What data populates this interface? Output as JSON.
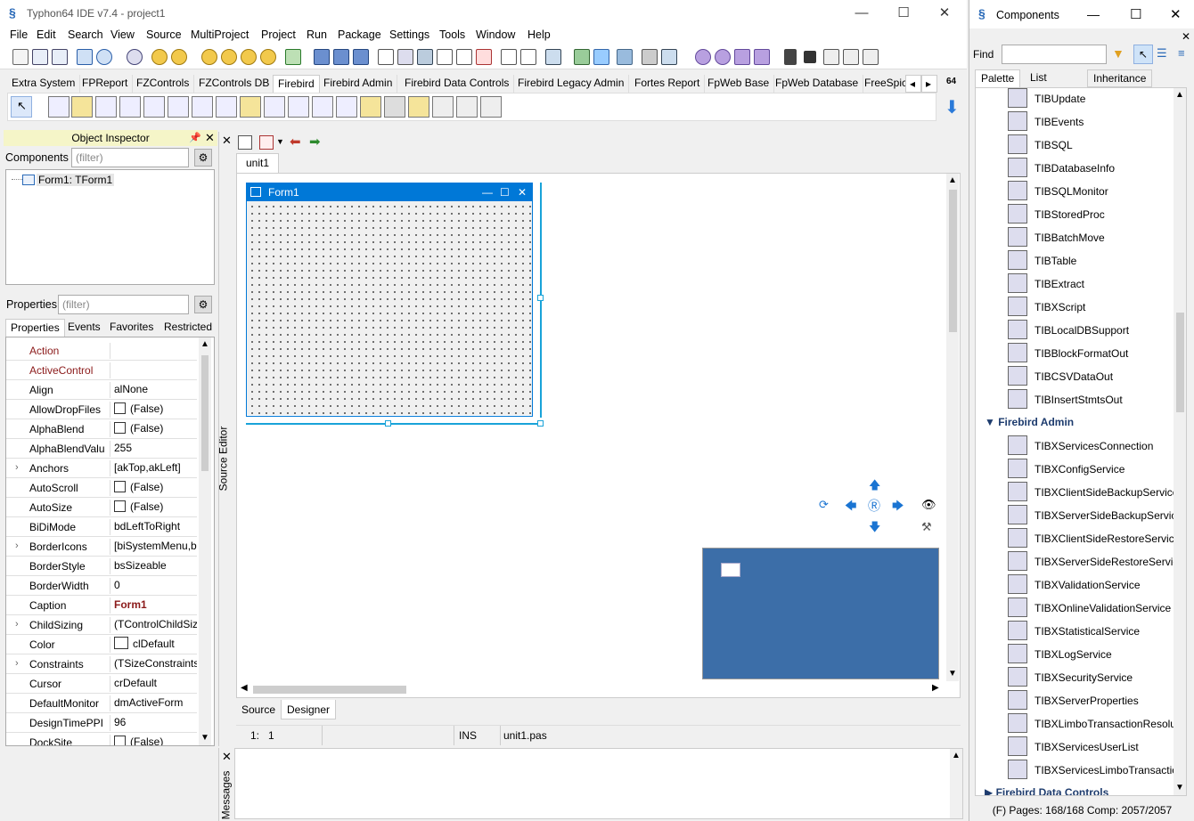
{
  "window": {
    "title": "Typhon64 IDE v7.4 - project1"
  },
  "menu": [
    "File",
    "Edit",
    "Search",
    "View",
    "Source",
    "MultiProject",
    "Project",
    "Run",
    "Package",
    "Settings",
    "Tools",
    "Window",
    "Help"
  ],
  "palette_tabs": [
    "Extra System",
    "FPReport",
    "FZControls",
    "FZControls DB",
    "Firebird",
    "Firebird Admin",
    "Firebird Data Controls",
    "Firebird Legacy Admin",
    "Fortes Report",
    "FpWeb Base",
    "FpWeb Database",
    "FreeSpic"
  ],
  "palette_active": "Firebird",
  "arch_badge": "64",
  "object_inspector": {
    "title": "Object Inspector",
    "components_label": "Components",
    "filter_placeholder": "(filter)",
    "tree_item": "Form1: TForm1",
    "properties_label": "Properties",
    "tabs": [
      "Properties",
      "Events",
      "Favorites",
      "Restricted"
    ],
    "properties": [
      {
        "name": "Action",
        "value": "",
        "style": "red"
      },
      {
        "name": "ActiveControl",
        "value": "",
        "style": "red"
      },
      {
        "name": "Align",
        "value": "alNone"
      },
      {
        "name": "AllowDropFiles",
        "value": "(False)",
        "check": true
      },
      {
        "name": "AlphaBlend",
        "value": "(False)",
        "check": true
      },
      {
        "name": "AlphaBlendValu",
        "value": "255"
      },
      {
        "name": "Anchors",
        "value": "[akTop,akLeft]",
        "expand": true
      },
      {
        "name": "AutoScroll",
        "value": "(False)",
        "check": true
      },
      {
        "name": "AutoSize",
        "value": "(False)",
        "check": true
      },
      {
        "name": "BiDiMode",
        "value": "bdLeftToRight"
      },
      {
        "name": "BorderIcons",
        "value": "[biSystemMenu,bi",
        "expand": true
      },
      {
        "name": "BorderStyle",
        "value": "bsSizeable"
      },
      {
        "name": "BorderWidth",
        "value": "0"
      },
      {
        "name": "Caption",
        "value": "Form1",
        "bold": true
      },
      {
        "name": "ChildSizing",
        "value": "(TControlChildSizir",
        "expand": true
      },
      {
        "name": "Color",
        "value": "clDefault",
        "swatch": true
      },
      {
        "name": "Constraints",
        "value": "(TSizeConstraints)",
        "expand": true
      },
      {
        "name": "Cursor",
        "value": "crDefault"
      },
      {
        "name": "DefaultMonitor",
        "value": "dmActiveForm"
      },
      {
        "name": "DesignTimePPI",
        "value": "96"
      },
      {
        "name": "DockSite",
        "value": "(False)",
        "check": true
      }
    ]
  },
  "editor": {
    "tab": "unit1",
    "form_caption": "Form1",
    "bottom_tabs": [
      "Source",
      "Designer"
    ],
    "status": {
      "pos": "1:   1",
      "mode": "INS",
      "file": "unit1.pas"
    },
    "source_editor_label": "Source Editor",
    "messages_label": "Messages"
  },
  "components": {
    "title": "Components",
    "find_label": "Find",
    "tabs": [
      "Palette",
      "List",
      "Inheritance"
    ],
    "items_firebird": [
      "TIBUpdate",
      "TIBEvents",
      "TIBSQL",
      "TIBDatabaseInfo",
      "TIBSQLMonitor",
      "TIBStoredProc",
      "TIBBatchMove",
      "TIBTable",
      "TIBExtract",
      "TIBXScript",
      "TIBLocalDBSupport",
      "TIBBlockFormatOut",
      "TIBCSVDataOut",
      "TIBInsertStmtsOut"
    ],
    "group_admin": "Firebird Admin",
    "items_admin": [
      "TIBXServicesConnection",
      "TIBXConfigService",
      "TIBXClientSideBackupService",
      "TIBXServerSideBackupService",
      "TIBXClientSideRestoreService",
      "TIBXServerSideRestoreService",
      "TIBXValidationService",
      "TIBXOnlineValidationService",
      "TIBXStatisticalService",
      "TIBXLogService",
      "TIBXSecurityService",
      "TIBXServerProperties",
      "TIBXLimboTransactionResoluti",
      "TIBXServicesUserList",
      "TIBXServicesLimboTransaction"
    ],
    "group_data": "Firebird Data Controls",
    "status": "(F) Pages: 168/168  Comp: 2057/2057"
  }
}
